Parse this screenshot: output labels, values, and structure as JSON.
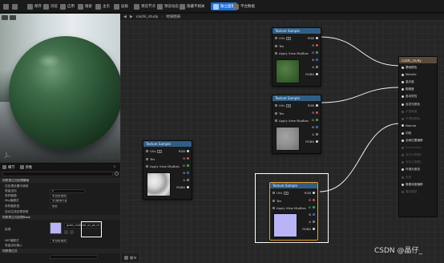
{
  "toolbar": {
    "items": [
      {
        "label": "保存"
      },
      {
        "label": "浏览"
      },
      {
        "label": "应用"
      },
      {
        "label": "搜索"
      },
      {
        "label": "主页"
      },
      {
        "label": "层级"
      },
      {
        "label": "预览节点"
      },
      {
        "label": "预览动态"
      },
      {
        "label": "隐藏不相关"
      },
      {
        "label": "独立面板"
      },
      {
        "label": "平台数据"
      }
    ]
  },
  "breadcrumb": {
    "back": "◀",
    "forward": "▶",
    "asset": "caizhi_study",
    "separator": "›",
    "page": "材质图表"
  },
  "details": {
    "tabs": [
      {
        "label": "细节"
      },
      {
        "label": "参数"
      }
    ],
    "close": "×",
    "sections": {
      "material": "材质表达式纹理基础",
      "texture": "材质表达式纹理Base",
      "misc": "材质表达式"
    },
    "rows": [
      {
        "label": "在纹理设置中使用",
        "value": ""
      },
      {
        "label": "常量坐标",
        "value": "0"
      },
      {
        "label": "采样器源",
        "value": "来自纹理资产"
      },
      {
        "label": "Mip值模式",
        "value": "无(使用计算好的Mip等级)"
      },
      {
        "label": "采样器类型",
        "value": "颜色"
      },
      {
        "label": "自动生成纹理参数",
        "value": ""
      },
      {
        "label": "MIP值模式",
        "value": ""
      },
      {
        "label": "常量坐标输入",
        "value": "0"
      }
    ],
    "texture": {
      "label": "纹理",
      "name": "grass_material_uv_gh_nt"
    },
    "graph_tab": "细节"
  },
  "nodes": [
    {
      "title": "Texture Sample",
      "inputs": [
        "UVs",
        "Tex",
        "Apply View MipBias"
      ],
      "uv_box": "0",
      "outputs": [
        "RGB",
        "R",
        "G",
        "B",
        "A",
        "RGBA"
      ]
    },
    {
      "title": "Texture Sample",
      "inputs": [
        "UVs",
        "Tex",
        "Apply View MipBias"
      ],
      "uv_box": "0",
      "outputs": [
        "RGB",
        "R",
        "G",
        "B",
        "A",
        "RGBA"
      ]
    },
    {
      "title": "Texture Sample",
      "inputs": [
        "UVs",
        "Tex",
        "Apply View MipBias"
      ],
      "uv_box": "0",
      "outputs": [
        "RGB",
        "R",
        "G",
        "B",
        "A",
        "RGBA"
      ]
    },
    {
      "title": "Texture Sample",
      "inputs": [
        "UVs",
        "Tex",
        "Apply View MipBias"
      ],
      "uv_box": "0",
      "outputs": [
        "RGB",
        "R",
        "G",
        "B",
        "A",
        "RGBA"
      ]
    }
  ],
  "result": {
    "title": "caizhi_study",
    "pins": [
      {
        "label": "基础颜色",
        "enabled": true
      },
      {
        "label": "Metallic",
        "enabled": true
      },
      {
        "label": "高光度",
        "enabled": true
      },
      {
        "label": "粗糙度",
        "enabled": true
      },
      {
        "label": "各向异性",
        "enabled": true
      },
      {
        "label": "自发光颜色",
        "enabled": true
      },
      {
        "label": "不透明度",
        "enabled": false
      },
      {
        "label": "不透明蒙版",
        "enabled": false
      },
      {
        "label": "Normal",
        "enabled": true
      },
      {
        "label": "切线",
        "enabled": true
      },
      {
        "label": "全局位置偏移",
        "enabled": true
      },
      {
        "label": "Subsurface",
        "enabled": false
      },
      {
        "label": "自定义数据0",
        "enabled": false
      },
      {
        "label": "自定义数据1",
        "enabled": false
      },
      {
        "label": "环境光遮挡",
        "enabled": true
      },
      {
        "label": "折射",
        "enabled": false
      },
      {
        "label": "像素深度偏移",
        "enabled": true
      },
      {
        "label": "着色模型",
        "enabled": false
      }
    ]
  },
  "colors": {
    "node_header": "#2f5f86",
    "selection_outline": "#f2a024",
    "wire": "#f0f0f0",
    "preview_green": "#3f6a34",
    "preview_gray": "#8f8f8f",
    "preview_white": "#d7d7d7",
    "preview_purple": "#b8b4f5",
    "accent_blue": "#1d6fd6"
  },
  "watermark": "CSDN @晶仔_"
}
